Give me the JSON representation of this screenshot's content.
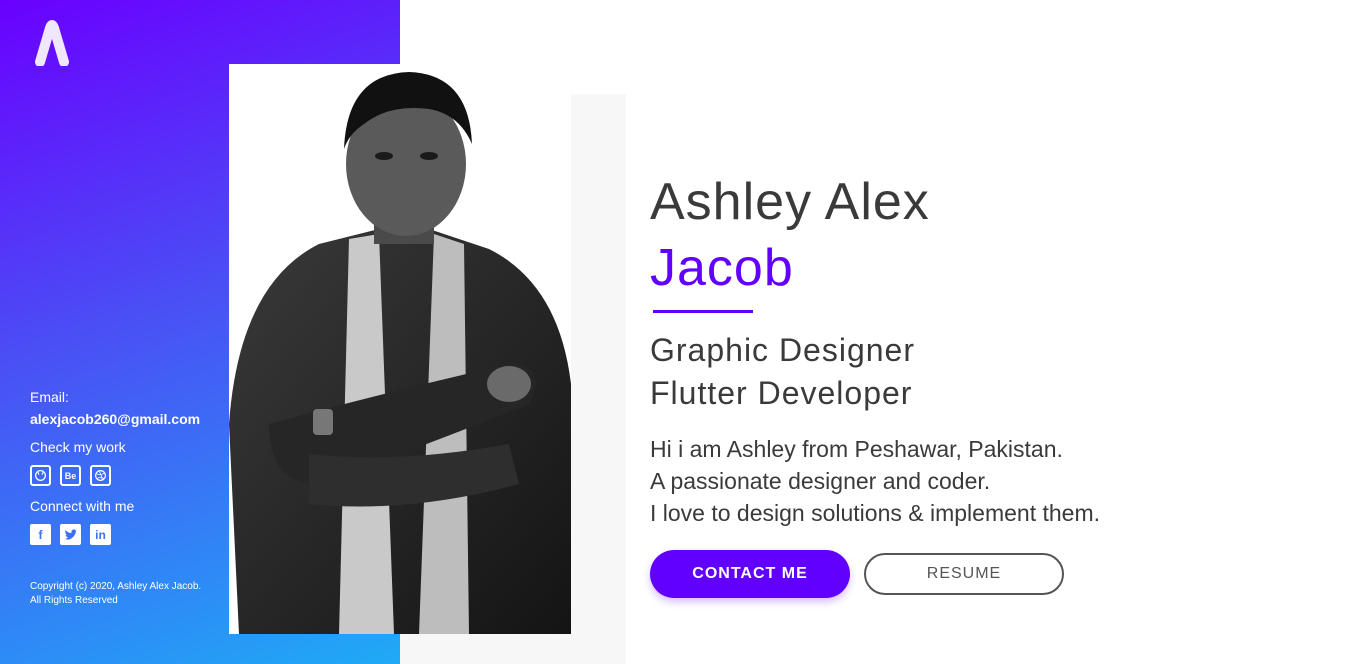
{
  "profile": {
    "first_name": "Ashley Alex",
    "last_name": "Jacob",
    "roles": [
      "Graphic Designer",
      "Flutter Developer"
    ],
    "bio": [
      "Hi i am Ashley from Peshawar, Pakistan.",
      "A passionate designer and coder.",
      "I love to design solutions & implement them."
    ]
  },
  "buttons": {
    "contact": "CONTACT ME",
    "resume": "RESUME"
  },
  "sidebar": {
    "email_label": "Email:",
    "email": "alexjacob260@gmail.com",
    "work_label": "Check my work",
    "work_icons": [
      "github-icon",
      "behance-icon",
      "dribbble-icon"
    ],
    "behance_text": "Be",
    "connect_label": "Connect with me",
    "social_icons": [
      "facebook-icon",
      "twitter-icon",
      "linkedin-icon"
    ],
    "copyright_line1": "Copyright (c) 2020, Ashley Alex Jacob.",
    "copyright_line2": "All Rights Reserved"
  },
  "colors": {
    "accent": "#6200ff",
    "text": "#3a3a3a",
    "gradient_top": "#6a00ff",
    "gradient_bottom": "#1faaf6"
  }
}
